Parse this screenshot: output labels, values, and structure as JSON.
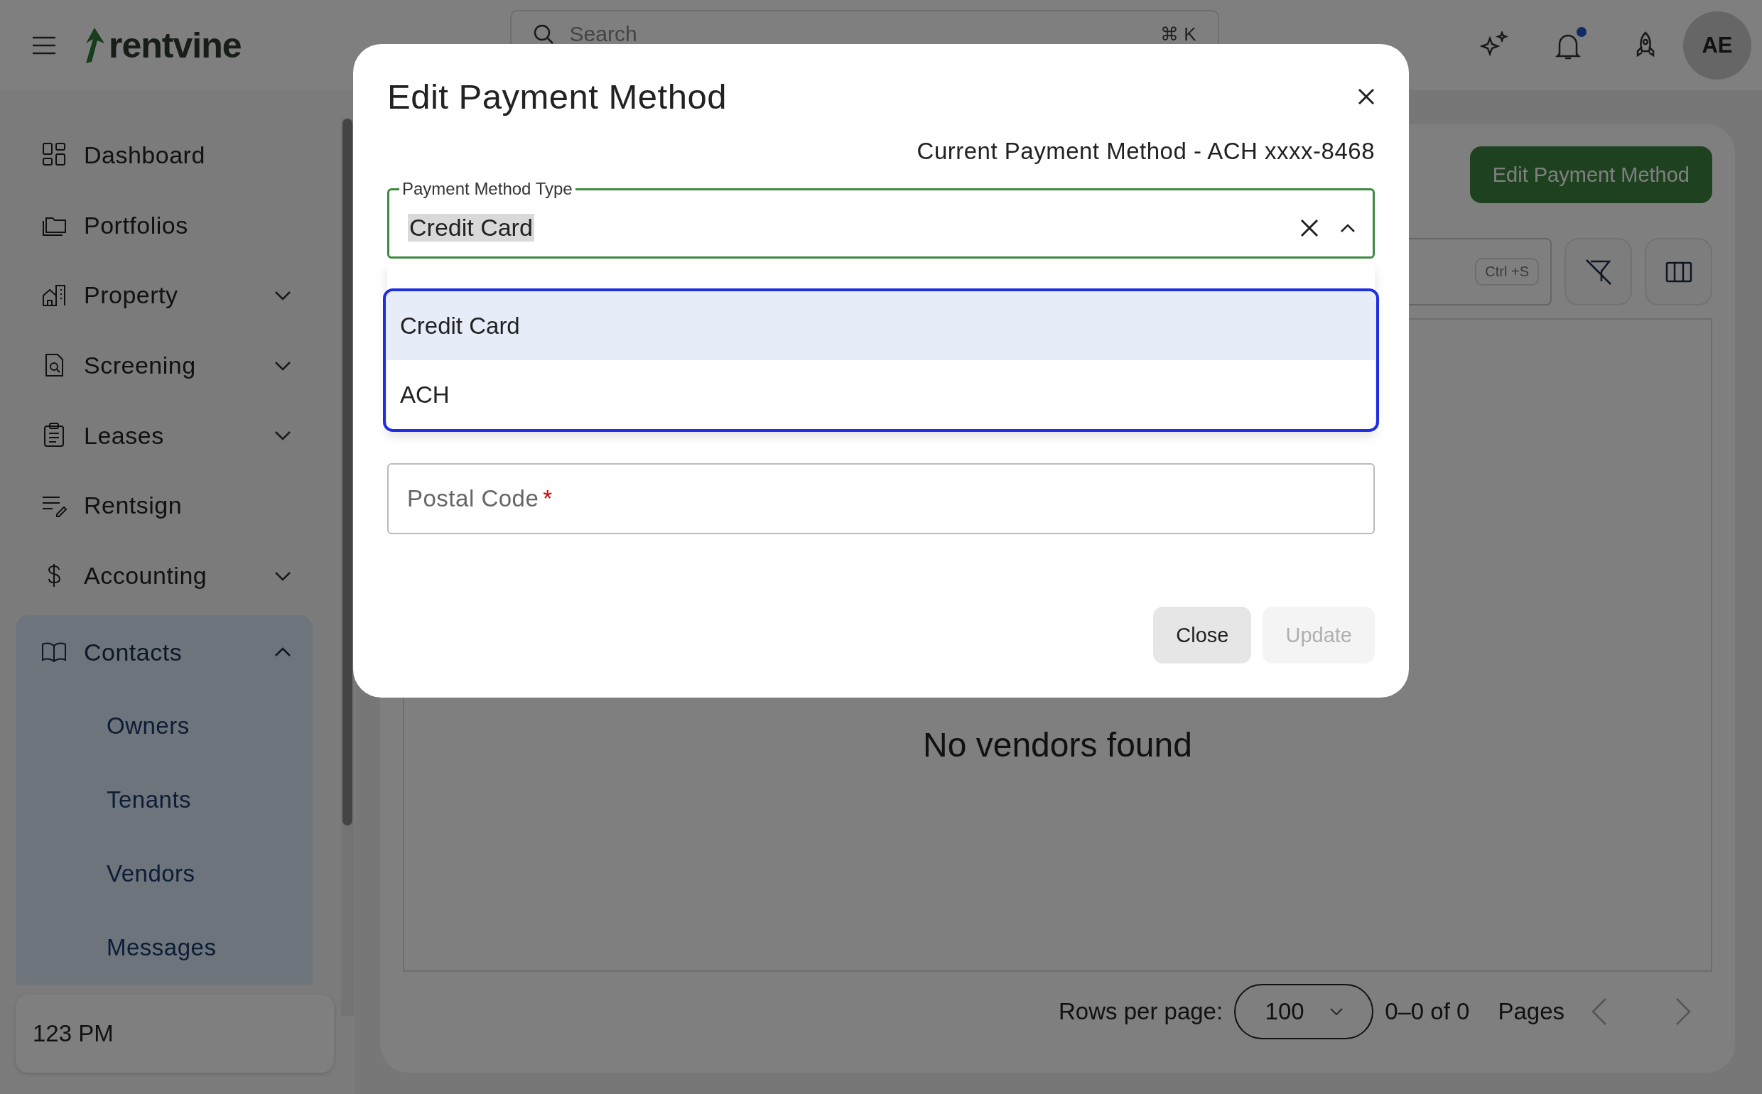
{
  "top_bar": {
    "logo": "rentvine",
    "search": {
      "placeholder": "Search",
      "shortcut": "⌘ K"
    },
    "notification_unread": true,
    "avatar": "AE"
  },
  "sidebar": {
    "items": [
      {
        "label": "Dashboard",
        "kind": "link"
      },
      {
        "label": "Portfolios",
        "kind": "link"
      },
      {
        "label": "Property",
        "kind": "group",
        "expanded": false
      },
      {
        "label": "Screening",
        "kind": "group",
        "expanded": false
      },
      {
        "label": "Leases",
        "kind": "group",
        "expanded": false
      },
      {
        "label": "Rentsign",
        "kind": "link"
      },
      {
        "label": "Accounting",
        "kind": "group",
        "expanded": false
      },
      {
        "label": "Contacts",
        "kind": "group",
        "expanded": true,
        "children": [
          {
            "label": "Owners"
          },
          {
            "label": "Tenants"
          },
          {
            "label": "Vendors"
          },
          {
            "label": "Messages"
          }
        ]
      }
    ],
    "footer": "123 PM"
  },
  "main": {
    "primary_button": "Edit Payment Method",
    "search_shortcut": "Ctrl +S",
    "empty_message": "No vendors found",
    "pagination": {
      "rows_per_page_label": "Rows per page:",
      "rows_per_page": "100",
      "range": "0–0 of 0",
      "pages_label": "Pages",
      "prev_disabled": true,
      "next_disabled": true
    }
  },
  "dialog": {
    "title": "Edit Payment Method",
    "current_method": "Current Payment Method - ACH xxxx-8468",
    "payment_type": {
      "label": "Payment Method Type",
      "value": "Credit Card",
      "open": true,
      "options": [
        {
          "label": "Credit Card",
          "selected": true
        },
        {
          "label": "ACH",
          "selected": false
        }
      ]
    },
    "postal_code": {
      "placeholder": "Postal Code",
      "required_mark": "*"
    },
    "buttons": [
      {
        "label": "Close",
        "disabled": false
      },
      {
        "label": "Update",
        "disabled": true
      }
    ]
  }
}
